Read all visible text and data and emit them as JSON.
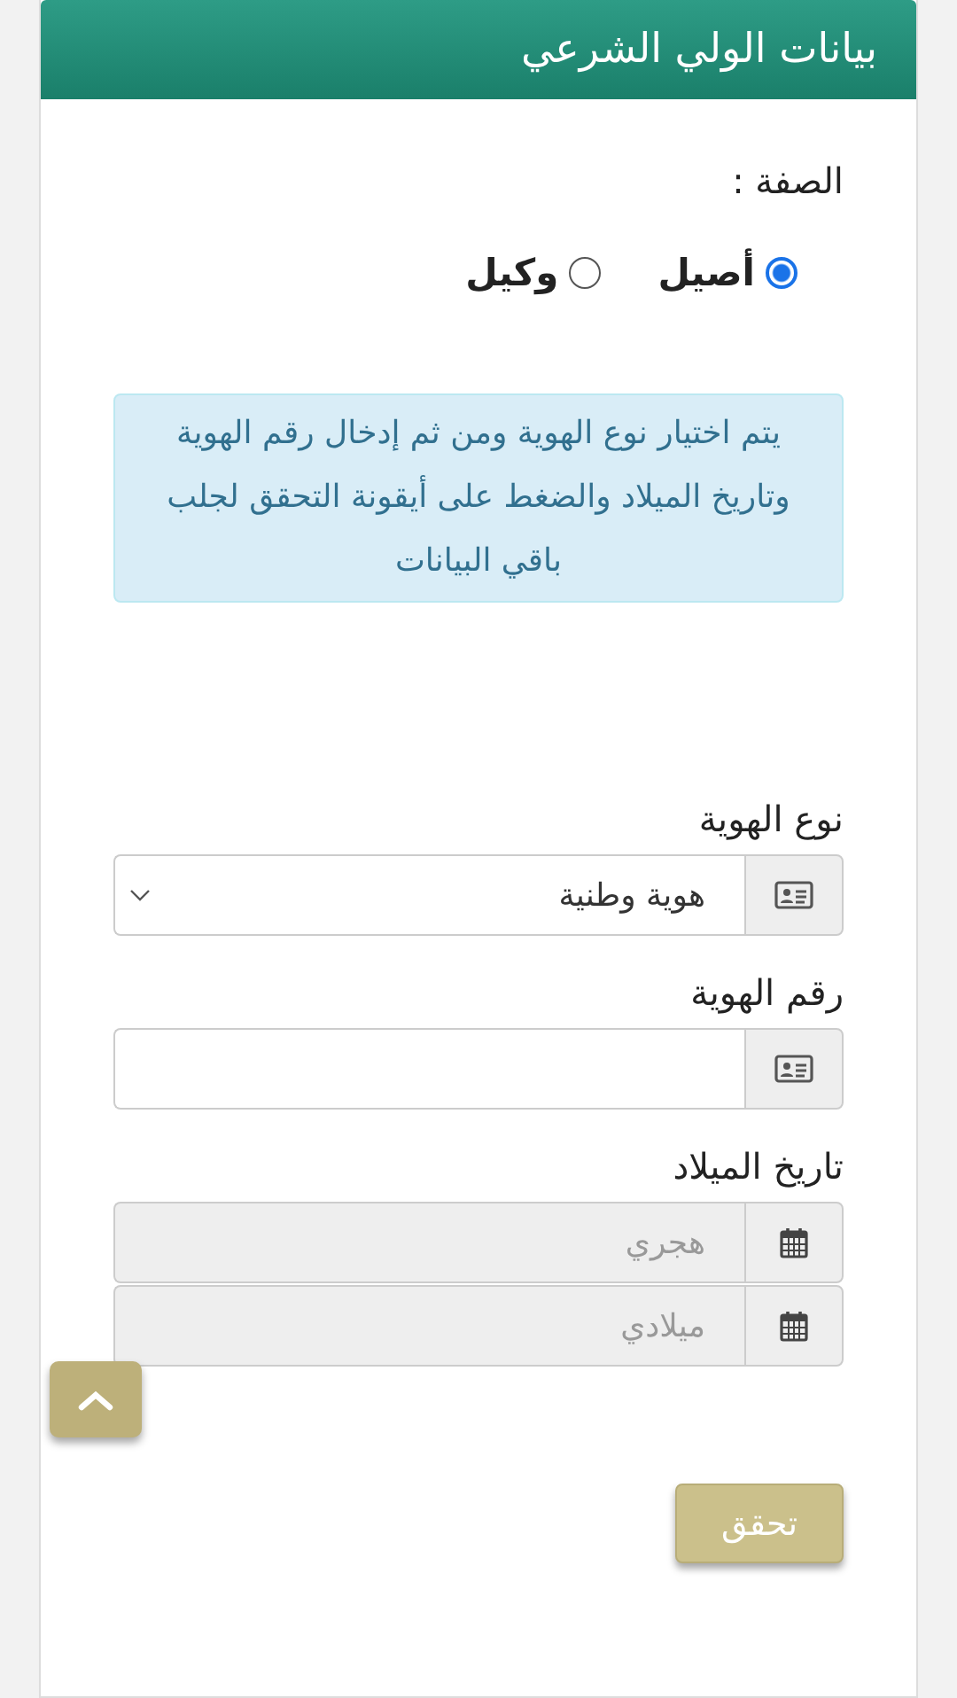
{
  "header": {
    "title": "بيانات الولي الشرعي"
  },
  "capacity": {
    "label": "الصفة :",
    "options": [
      {
        "label": "أصيل",
        "selected": true
      },
      {
        "label": "وكيل",
        "selected": false
      }
    ]
  },
  "info": "يتم اختيار نوع الهوية ومن ثم إدخال رقم الهوية وتاريخ الميلاد والضغط على أيقونة التحقق لجلب باقي البيانات",
  "fields": [
    {
      "kind": "select",
      "label": "نوع الهوية",
      "value": "هوية وطنية"
    },
    {
      "kind": "text",
      "label": "رقم الهوية"
    },
    {
      "kind": "dates",
      "label": "تاريخ الميلاد",
      "inputs": [
        {
          "placeholder": "هجري"
        },
        {
          "placeholder": "ميلادي"
        }
      ]
    }
  ],
  "verify_button": "تحقق"
}
